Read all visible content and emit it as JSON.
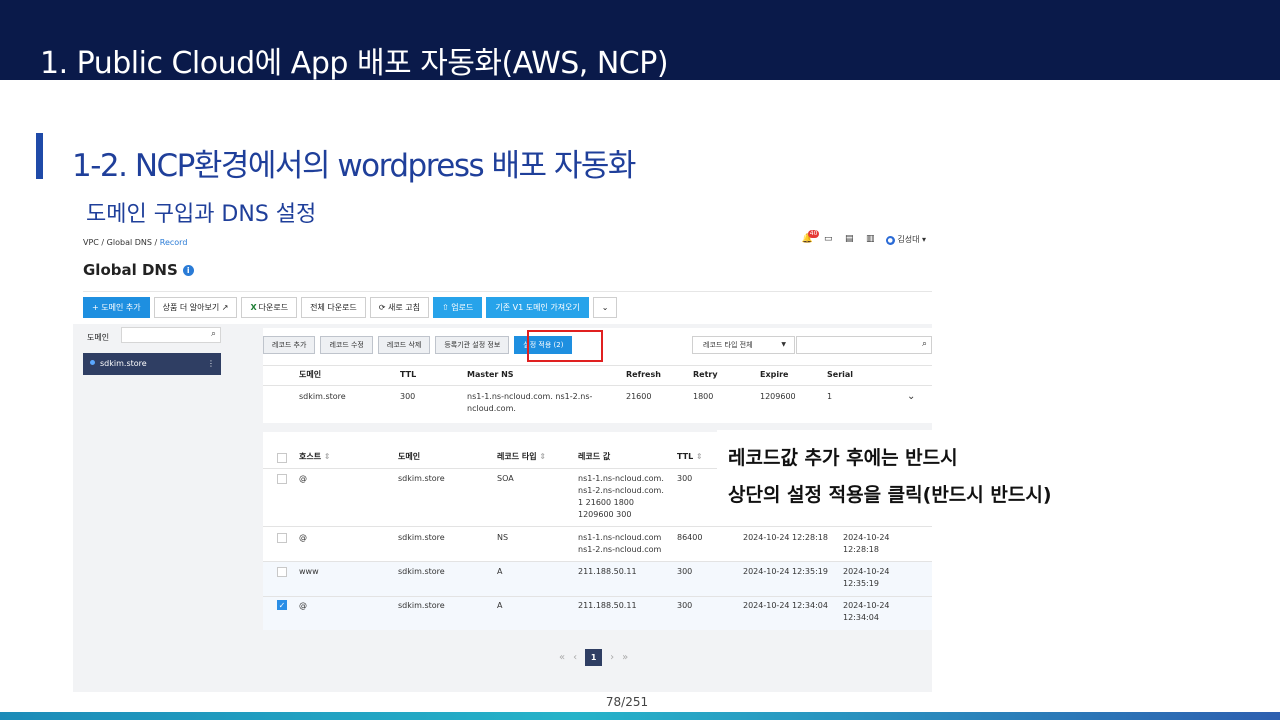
{
  "slide": {
    "title": "1. Public Cloud에 App 배포 자동화(AWS, NCP)",
    "section": "1-2. NCP환경에서의 wordpress 배포 자동화",
    "subtitle": "도메인 구입과 DNS 설정",
    "page": "78/251",
    "callout_line1": "레코드값 추가 후에는 반드시",
    "callout_line2": "상단의 설정 적용을 클릭(반드시 반드시)"
  },
  "console": {
    "breadcrumb": {
      "vpc": "VPC /",
      "gdns": "Global DNS /",
      "record": "Record"
    },
    "notification_count": "40",
    "user": "김성대",
    "page_title": "Global DNS",
    "info_icon": "i",
    "toolbar": {
      "add_domain": "+ 도메인 추가",
      "learn_more": "상품 더 알아보기 ↗",
      "download": "다운로드",
      "download_all": "전체 다운로드",
      "refresh": "⟳ 새로 고침",
      "upload": "⇧ 업로드",
      "import_existing": "기존 V1 도메인 가져오기",
      "more": "⌄"
    },
    "sidebar": {
      "label": "도메인",
      "search_placeholder": "",
      "selected_domain": "sdkim.store"
    },
    "record_buttons": {
      "add": "레코드 추가",
      "edit": "레코드 수정",
      "delete": "레코드 삭제",
      "registrar": "등록기관 설정 정보",
      "apply": "설정 적용 (2)"
    },
    "type_filter": "레코드 타입 전체",
    "domain_table": {
      "headers": [
        "도메인",
        "TTL",
        "Master NS",
        "Refresh",
        "Retry",
        "Expire",
        "Serial"
      ],
      "row": [
        "sdkim.store",
        "300",
        "ns1-1.ns-ncloud.com. ns1-2.ns-",
        "ncloud.com.",
        "21600",
        "1800",
        "1209600",
        "1"
      ]
    },
    "record_table": {
      "headers": [
        "호스트",
        "도메인",
        "레코드 타입",
        "레코드 값",
        "TTL"
      ],
      "rows": [
        {
          "host": "@",
          "domain": "sdkim.store",
          "type": "SOA",
          "v1": "ns1-1.ns-ncloud.com.",
          "v2": "ns1-2.ns-ncloud.com.",
          "v3": "1 21600 1800",
          "v4": "1209600 300",
          "ttl": "300",
          "created": "",
          "modified1": "",
          "modified2": ""
        },
        {
          "host": "@",
          "domain": "sdkim.store",
          "type": "NS",
          "v1": "ns1-1.ns-ncloud.com",
          "v2": "ns1-2.ns-ncloud.com",
          "v3": "",
          "v4": "",
          "ttl": "86400",
          "created": "2024-10-24 12:28:18",
          "modified1": "2024-10-24",
          "modified2": "12:28:18"
        },
        {
          "host": "www",
          "domain": "sdkim.store",
          "type": "A",
          "v1": "211.188.50.11",
          "v2": "",
          "v3": "",
          "v4": "",
          "ttl": "300",
          "created": "2024-10-24 12:35:19",
          "modified1": "2024-10-24",
          "modified2": "12:35:19"
        },
        {
          "host": "@",
          "domain": "sdkim.store",
          "type": "A",
          "v1": "211.188.50.11",
          "v2": "",
          "v3": "",
          "v4": "",
          "ttl": "300",
          "created": "2024-10-24 12:34:04",
          "modified1": "2024-10-24",
          "modified2": "12:34:04"
        }
      ]
    },
    "pager": {
      "first": "«",
      "prev": "‹",
      "current": "1",
      "next": "›",
      "last": "»"
    }
  }
}
